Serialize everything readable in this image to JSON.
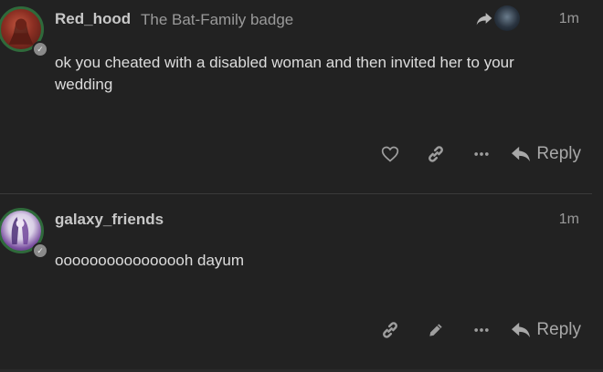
{
  "posts": [
    {
      "username": "Red_hood",
      "badge": "The Bat-Family badge",
      "time": "1m",
      "content": "ok you cheated with a disabled woman and then invited her to your wedding",
      "flair_icon": "checkmark-icon",
      "actions": [
        "like-icon",
        "link-icon",
        "more-icon"
      ],
      "reply_label": "Reply"
    },
    {
      "username": "galaxy_friends",
      "time": "1m",
      "content": "oooooooooooooooh dayum",
      "flair_icon": "checkmark-icon",
      "actions": [
        "link-icon",
        "edit-icon",
        "more-icon"
      ],
      "reply_label": "Reply"
    }
  ],
  "colors": {
    "background": "#222222",
    "avatar_ring": "#2f6a3b",
    "text": "#dddddd",
    "muted": "#9a9a9a"
  }
}
